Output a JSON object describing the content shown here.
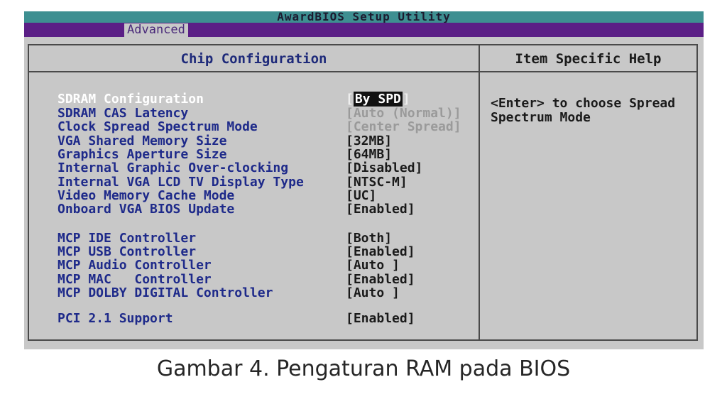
{
  "window": {
    "title": "AwardBIOS Setup Utility",
    "active_tab": "Advanced"
  },
  "panel": {
    "left_title": "Chip Configuration",
    "right_title": "Item Specific Help",
    "help_text": "<Enter> to choose Spread\nSpectrum Mode"
  },
  "settings": [
    {
      "label": "SDRAM Configuration",
      "value": "By SPD",
      "state": "selected"
    },
    {
      "label": "SDRAM CAS Latency",
      "value": "Auto (Normal)",
      "state": "disabled"
    },
    {
      "label": "Clock Spread Spectrum Mode",
      "value": "Center Spread",
      "state": "disabled"
    },
    {
      "label": "VGA Shared Memory Size",
      "value": "32MB",
      "state": "normal"
    },
    {
      "label": "Graphics Aperture Size",
      "value": "64MB",
      "state": "normal"
    },
    {
      "label": "Internal Graphic Over-clocking",
      "value": "Disabled",
      "state": "normal"
    },
    {
      "label": "Internal VGA LCD TV Display Type",
      "value": "NTSC-M",
      "state": "normal"
    },
    {
      "label": "Video Memory Cache Mode",
      "value": "UC",
      "state": "normal"
    },
    {
      "label": "Onboard VGA BIOS Update",
      "value": "Enabled",
      "state": "normal"
    },
    {
      "label": "MCP IDE Controller",
      "value": "Both",
      "state": "normal"
    },
    {
      "label": "MCP USB Controller",
      "value": "Enabled",
      "state": "normal"
    },
    {
      "label": "MCP Audio Controller",
      "value": "Auto ",
      "state": "normal"
    },
    {
      "label": "MCP MAC   Controller",
      "value": "Enabled",
      "state": "normal"
    },
    {
      "label": "MCP DOLBY DIGITAL Controller",
      "value": "Auto ",
      "state": "normal"
    },
    {
      "label": "PCI 2.1 Support",
      "value": "Enabled",
      "state": "normal"
    }
  ],
  "caption": "Gambar 4. Pengaturan RAM pada BIOS",
  "colors": {
    "title_bar": "#3e8f91",
    "menu_bar": "#5b1f86",
    "background": "#c8c8c8",
    "label_text": "#1e2a8a",
    "selected_label": "#ffffff",
    "disabled_value": "#9a9a9a"
  }
}
